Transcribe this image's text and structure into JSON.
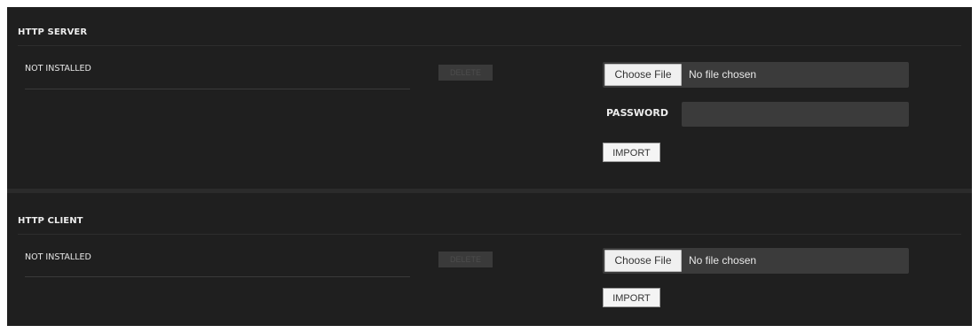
{
  "http_server": {
    "title": "HTTP SERVER",
    "status": "NOT INSTALLED",
    "delete_label": "DELETE",
    "choose_file_label": "Choose File",
    "file_status": "No file chosen",
    "password_label": "PASSWORD",
    "password_value": "",
    "import_label": "IMPORT"
  },
  "http_client": {
    "title": "HTTP CLIENT",
    "status": "NOT INSTALLED",
    "delete_label": "DELETE",
    "choose_file_label": "Choose File",
    "file_status": "No file chosen",
    "import_label": "IMPORT"
  },
  "colors": {
    "background": "#1f1f1f",
    "field_background": "#3b3b3b",
    "text": "#ececec",
    "disabled_button": "#3a3a3a"
  }
}
